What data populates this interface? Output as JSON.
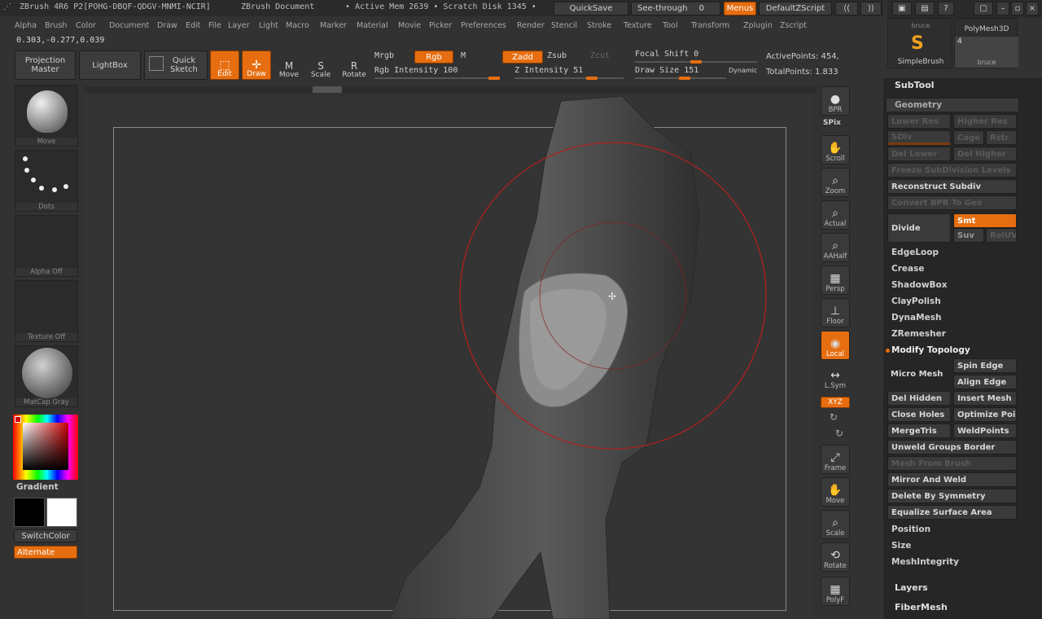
{
  "title": {
    "app": "ZBrush 4R6 P2[POHG-DBQF-QDGV-MNMI-NCIR]",
    "doc": "ZBrush Document",
    "mem": "• Active Mem 2639 • Scratch Disk 1345 •",
    "quicksave": "QuickSave",
    "seethrough": "See-through",
    "seethrough_val": "0",
    "menus": "Menus",
    "script": "DefaultZScript"
  },
  "menu": [
    "Alpha",
    "Brush",
    "Color",
    "Document",
    "Draw",
    "Edit",
    "File",
    "Layer",
    "Light",
    "Macro",
    "Marker",
    "Material",
    "Movie",
    "Picker",
    "Preferences",
    "Render",
    "Stencil",
    "Stroke",
    "Texture",
    "Tool",
    "Transform",
    "Zplugin",
    "Zscript"
  ],
  "coords": "0.303,-0.277,0.039",
  "toolbar": {
    "projection": "Projection Master",
    "lightbox": "LightBox",
    "quicksketch": "Quick Sketch",
    "edit": "Edit",
    "draw": "Draw",
    "move": "Move",
    "scale": "Scale",
    "rotate": "Rotate",
    "mrgb": "Mrgb",
    "rgb": "Rgb",
    "m": "M",
    "zadd": "Zadd",
    "zsub": "Zsub",
    "zcut": "Zcut",
    "rgb_int": "Rgb Intensity 100",
    "z_int": "Z Intensity 51",
    "focal": "Focal Shift 0",
    "drawsize": "Draw Size 151",
    "dynamic": "Dynamic",
    "activepoints": "ActivePoints: 454,",
    "totalpoints": "TotalPoints: 1.833"
  },
  "left": {
    "move": "Move",
    "dots": "Dots",
    "alpha": "Alpha Off",
    "texture": "Texture Off",
    "matcap": "MatCap Gray",
    "gradient": "Gradient",
    "switchcolor": "SwitchColor",
    "alternate": "Alternate"
  },
  "right": [
    "BPR",
    "Scroll",
    "Zoom",
    "Actual",
    "AAHalf",
    "Persp",
    "Floor",
    "Local",
    "L.Sym",
    "XYZ",
    "Frame",
    "Move",
    "Scale",
    "Rotate",
    "PolyF"
  ],
  "spix": "SPix",
  "tools": {
    "bruce": "bruce",
    "polymesh": "PolyMesh3D",
    "simplebrush": "SimpleBrush",
    "bruce2": "bruce",
    "count": "4"
  },
  "panel": {
    "subtool": "SubTool",
    "geometry": "Geometry",
    "lower": "Lower Res",
    "higher": "Higher Res",
    "sdiv": "SDiv",
    "cage": "Cage",
    "rstr": "Rstr",
    "dellower": "Del Lower",
    "delhigher": "Del Higher",
    "freeze": "Freeze SubDivision Levels",
    "reconstruct": "Reconstruct Subdiv",
    "convert": "Convert BPR To Geo",
    "divide": "Divide",
    "smt": "Smt",
    "suv": "Suv",
    "reluv": "RelUV",
    "edgeloop": "EdgeLoop",
    "crease": "Crease",
    "shadowbox": "ShadowBox",
    "claypolish": "ClayPolish",
    "dynamesh": "DynaMesh",
    "zremesher": "ZRemesher",
    "modify": "Modify Topology",
    "spin": "Spin Edge",
    "micromesh": "Micro Mesh",
    "align": "Align Edge",
    "delhidden": "Del Hidden",
    "insert": "Insert Mesh",
    "closeholes": "Close Holes",
    "optimize": "Optimize Poi",
    "mergetris": "MergeTris",
    "weldpoints": "WeldPoints",
    "unweld": "Unweld Groups Border",
    "meshfrombrush": "Mesh From Brush",
    "mirror": "Mirror And Weld",
    "delsym": "Delete By Symmetry",
    "equalize": "Equalize Surface Area",
    "position": "Position",
    "size": "Size",
    "integrity": "MeshIntegrity",
    "layers": "Layers",
    "fibermesh": "FiberMesh"
  }
}
